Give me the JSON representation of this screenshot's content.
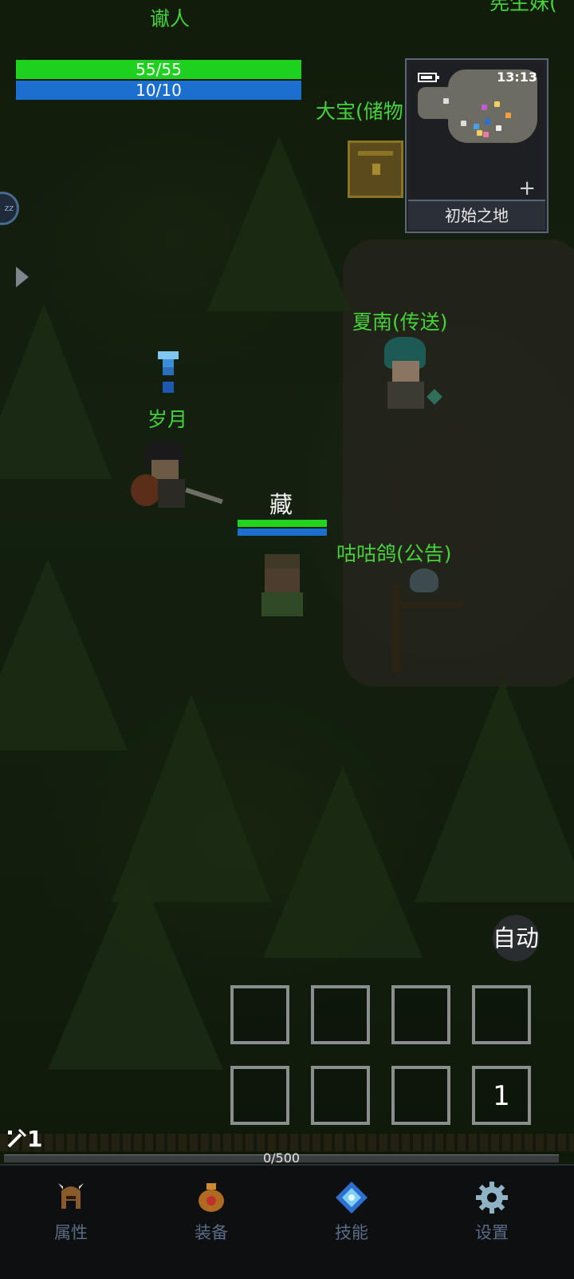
{
  "player": {
    "name": "谳人",
    "hp_text": "55/55",
    "mp_text": "10/10"
  },
  "npcs": {
    "storage_label": "大宝(储物",
    "top_right_label": "宪生妹(",
    "teleport_label": "夏南(传送)",
    "announce_label": "咕咕鸽(公告)",
    "other_player_label": "岁月",
    "enemy_label": "藏"
  },
  "minimap": {
    "time": "13:13",
    "location": "初始之地",
    "zoom_symbol": "+"
  },
  "side": {
    "sleep_label": "zz"
  },
  "controls": {
    "auto_label": "自动",
    "hotbar_slot_8_label": "1"
  },
  "status": {
    "wand_count": "1",
    "exp_text": "0/500"
  },
  "nav": {
    "items": [
      {
        "label": "属性",
        "icon": "helmet-icon"
      },
      {
        "label": "装备",
        "icon": "bag-icon"
      },
      {
        "label": "技能",
        "icon": "skill-gem-icon"
      },
      {
        "label": "设置",
        "icon": "gear-icon"
      }
    ]
  },
  "colors": {
    "npc_name": "#46d23a",
    "hp": "#1fd11f",
    "mp": "#1b6fcf",
    "nav_label": "#5b6c86"
  }
}
